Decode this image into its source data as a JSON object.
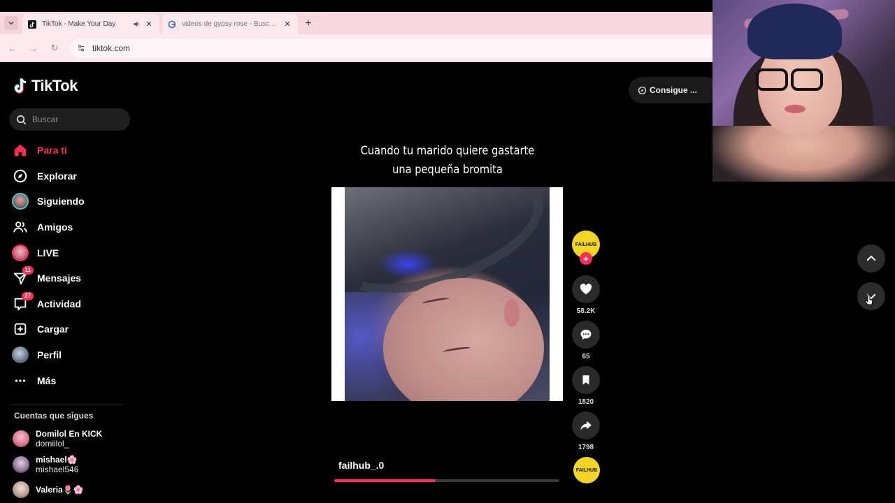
{
  "browser": {
    "tabs": [
      {
        "title": "TikTok - Make Your Day",
        "active": true
      },
      {
        "title": "videos de gypsy rose - Buscar c",
        "active": false
      }
    ],
    "url": "tiktok.com"
  },
  "brand": {
    "name": "TikTok",
    "accent": "#fe2c55"
  },
  "search": {
    "placeholder": "Buscar"
  },
  "header": {
    "get_app_label": "Consigue ..."
  },
  "nav": [
    {
      "label": "Para ti",
      "icon": "home-icon",
      "active": true
    },
    {
      "label": "Explorar",
      "icon": "compass-icon"
    },
    {
      "label": "Siguiendo",
      "icon": "following-avatar-icon"
    },
    {
      "label": "Amigos",
      "icon": "friends-icon"
    },
    {
      "label": "LIVE",
      "icon": "live-icon"
    },
    {
      "label": "Mensajes",
      "icon": "messages-icon",
      "badge": "11"
    },
    {
      "label": "Actividad",
      "icon": "activity-icon",
      "badge": "27"
    },
    {
      "label": "Cargar",
      "icon": "upload-icon"
    },
    {
      "label": "Perfil",
      "icon": "profile-avatar-icon"
    },
    {
      "label": "Más",
      "icon": "more-icon"
    }
  ],
  "following": {
    "title": "Cuentas que sigues",
    "accounts": [
      {
        "name": "Domilol En KICK",
        "handle": "domiilol_"
      },
      {
        "name": "mishael🌸",
        "handle": "mishael546"
      },
      {
        "name": "Valeria🌷🌸",
        "handle": ""
      }
    ]
  },
  "video": {
    "caption_line1": "Cuando tu marido quiere gastarte",
    "caption_line2": "una pequeña bromita",
    "author": "failhub_.0",
    "progress_percent": 45,
    "creator_avatar_text": "FAILHUB"
  },
  "actions": {
    "likes": "58.2K",
    "comments": "65",
    "saves": "1820",
    "shares": "1798"
  }
}
